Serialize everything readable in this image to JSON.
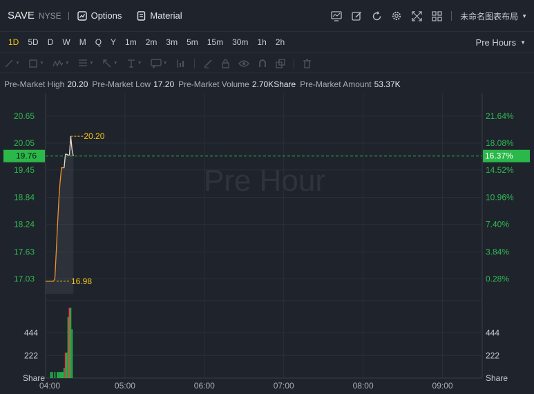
{
  "header": {
    "symbol": "SAVE",
    "exchange": "NYSE",
    "options_label": "Options",
    "material_label": "Material",
    "layout_name": "未命名图表布局"
  },
  "timeframes": [
    "1D",
    "5D",
    "D",
    "W",
    "M",
    "Q",
    "Y",
    "1m",
    "2m",
    "3m",
    "5m",
    "15m",
    "30m",
    "1h",
    "2h"
  ],
  "active_timeframe": "1D",
  "session_selector": "Pre Hours",
  "premarket": {
    "high_label": "Pre-Market High",
    "high": "20.20",
    "low_label": "Pre-Market Low",
    "low": "17.20",
    "volume_label": "Pre-Market Volume",
    "volume": "2.70KShare",
    "amount_label": "Pre-Market Amount",
    "amount": "53.37K"
  },
  "chart": {
    "watermark": "Pre Hour",
    "current_price": "19.76",
    "current_pct": "16.37%",
    "high_marker": "20.20",
    "low_marker": "16.98",
    "price_ticks": [
      {
        "price": 20.65,
        "label": "20.65",
        "pct": "21.64%"
      },
      {
        "price": 20.05,
        "label": "20.05",
        "pct": "18.08%"
      },
      {
        "price": 19.45,
        "label": "19.45",
        "pct": "14.52%"
      },
      {
        "price": 18.84,
        "label": "18.84",
        "pct": "10.96%"
      },
      {
        "price": 18.24,
        "label": "18.24",
        "pct": "7.40%"
      },
      {
        "price": 17.63,
        "label": "17.63",
        "pct": "3.84%"
      },
      {
        "price": 17.03,
        "label": "17.03",
        "pct": "0.28%"
      }
    ],
    "volume_ticks": [
      {
        "value": 444,
        "label": "444"
      },
      {
        "value": 222,
        "label": "222"
      }
    ],
    "volume_unit": "Share",
    "time_labels": [
      "04:00",
      "05:00",
      "06:00",
      "07:00",
      "08:00",
      "09:00"
    ],
    "colors": {
      "up": "#24b34a",
      "down": "#e04646",
      "line": "#f0922e",
      "avg_line": "#d9dce0",
      "marker": "#f5c518",
      "price_badge": "#2bb84a"
    }
  },
  "chart_data": {
    "type": "line",
    "x": [
      "04:00",
      "04:01",
      "04:02",
      "04:03",
      "04:04",
      "04:05",
      "04:06",
      "04:07",
      "04:08",
      "04:09",
      "04:10",
      "04:11",
      "04:12",
      "04:13",
      "04:14",
      "04:15",
      "04:16",
      "04:17",
      "04:18",
      "04:19",
      "04:20",
      "04:21"
    ],
    "series": [
      {
        "values": [
          16.98,
          16.98,
          16.98,
          16.98,
          16.98,
          16.98,
          16.98,
          17.03,
          17.6,
          18.2,
          18.8,
          19.2,
          19.5,
          19.5,
          19.5,
          19.8,
          19.8,
          19.78,
          19.78,
          20.2,
          19.9,
          19.76
        ]
      }
    ],
    "volume_x": [
      "04:04",
      "04:05",
      "04:07",
      "04:09",
      "04:10",
      "04:11",
      "04:12",
      "04:13",
      "04:14",
      "04:15",
      "04:16",
      "04:17",
      "04:18",
      "04:19",
      "04:20"
    ],
    "volume_values": [
      60,
      60,
      60,
      60,
      60,
      60,
      60,
      60,
      100,
      250,
      250,
      600,
      690,
      690,
      480
    ],
    "volume_colors": [
      "up",
      "up",
      "up",
      "up",
      "up",
      "up",
      "up",
      "up",
      "up",
      "down",
      "up",
      "up",
      "down",
      "up",
      "up"
    ],
    "ylim": [
      16.7,
      21.0
    ],
    "volume_ylim": [
      0,
      760
    ]
  }
}
